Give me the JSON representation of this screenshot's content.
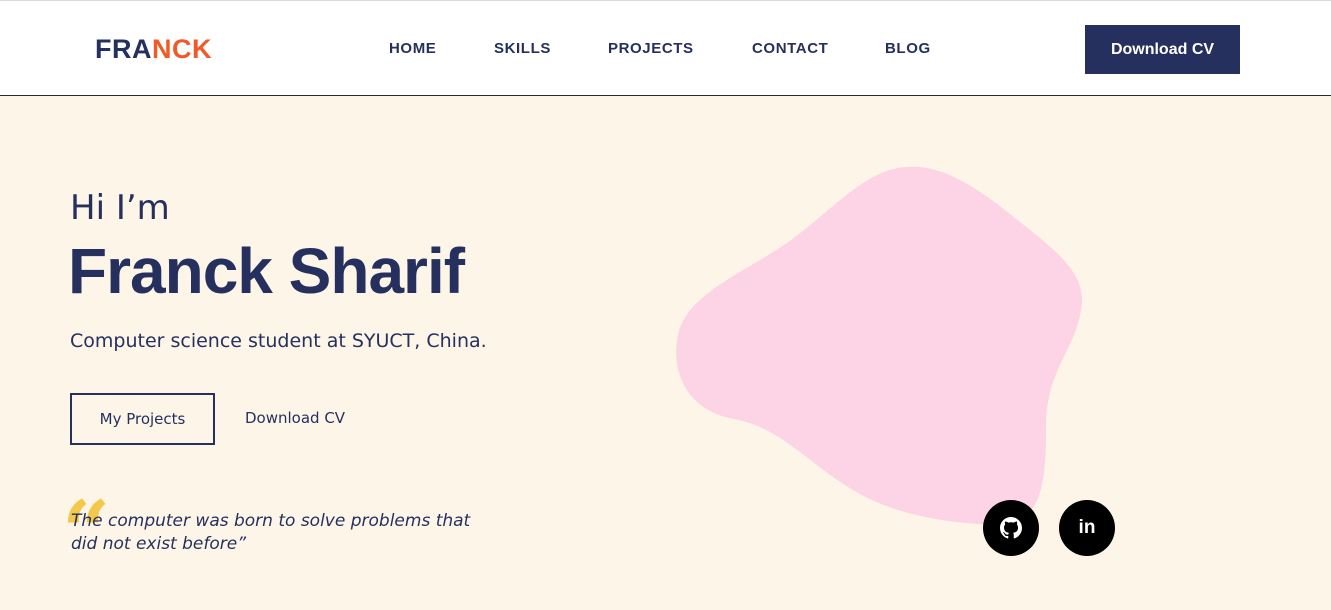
{
  "header": {
    "logo_part_a": "FRA",
    "logo_part_b": "NCK",
    "nav": [
      {
        "label": "HOME"
      },
      {
        "label": "SKILLS"
      },
      {
        "label": "PROJECTS"
      },
      {
        "label": "CONTACT"
      },
      {
        "label": "BLOG"
      }
    ],
    "cta_label": "Download CV"
  },
  "hero": {
    "greeting": "Hi I’m",
    "name": "Franck Sharif",
    "subtitle": "Computer science student at SYUCT, China.",
    "primary_button": "My Projects",
    "secondary_link": "Download CV"
  },
  "quote": {
    "mark": "“",
    "text": "The computer was born to solve problems that did not exist before”"
  },
  "social": {
    "github_icon": "github-icon",
    "linkedin_icon": "linkedin-icon",
    "linkedin_label": "in"
  },
  "colors": {
    "navy": "#25305e",
    "accent_orange": "#f05a28",
    "background": "#fdf6e8",
    "blob_pink": "#fdd3e6",
    "quote_yellow": "#f4c84a"
  }
}
